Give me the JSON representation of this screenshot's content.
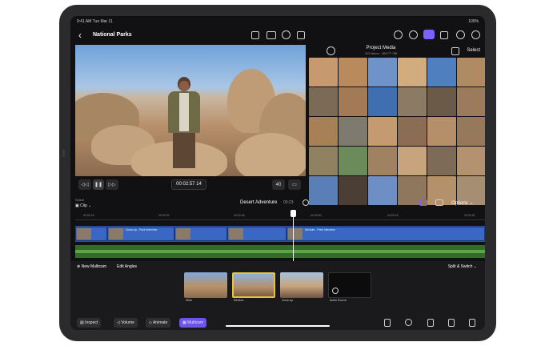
{
  "status": {
    "time": "9:41 AM",
    "date": "Tue Mar 11",
    "battery": "100%"
  },
  "topbar": {
    "back": "‹",
    "project_title": "National Parks"
  },
  "viewer": {
    "timecode": "00:02:57 14",
    "zoom": "40"
  },
  "browser": {
    "title": "Project Media",
    "subtitle": "103 Items · 459.77 GB",
    "select": "Select"
  },
  "timeline": {
    "select_label": "Select",
    "clip_label": "Clip",
    "name": "Desert Adventure",
    "duration": "09:23",
    "options": "Options",
    "ruler": [
      "00:02:15",
      "00:02:30",
      "00:02:45",
      "00:03:00",
      "00:03:15",
      "00:03:30"
    ],
    "clips": [
      "Close-up - Park Interview",
      "Medium - Park Interview"
    ]
  },
  "multicam": {
    "new": "New Multicam",
    "edit_angles": "Edit Angles",
    "split": "Split & Switch",
    "angles": [
      "Wide",
      "Medium",
      "Close-up",
      "Audio Source"
    ]
  },
  "tabs": {
    "inspect": "Inspect",
    "volume": "Volume",
    "animate": "Animate",
    "multicam": "Multicam"
  },
  "colors": {
    "accent": "#7b61ff",
    "video_track": "#3a66c4",
    "audio_track": "#356b2a"
  }
}
